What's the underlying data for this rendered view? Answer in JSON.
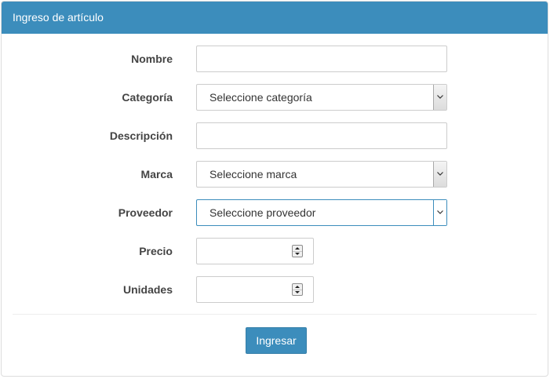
{
  "panel": {
    "title": "Ingreso de artículo"
  },
  "form": {
    "nombre": {
      "label": "Nombre",
      "value": ""
    },
    "categoria": {
      "label": "Categoría",
      "selected": "Seleccione categoría"
    },
    "descripcion": {
      "label": "Descripción",
      "value": ""
    },
    "marca": {
      "label": "Marca",
      "selected": "Seleccione marca"
    },
    "proveedor": {
      "label": "Proveedor",
      "selected": "Seleccione proveedor"
    },
    "precio": {
      "label": "Precio",
      "value": ""
    },
    "unidades": {
      "label": "Unidades",
      "value": ""
    }
  },
  "actions": {
    "submit_label": "Ingresar"
  },
  "colors": {
    "header": "#3c8dbc",
    "button": "#3c8dbc",
    "label_text": "#444444"
  },
  "icons": {
    "select_arrow": "chevron-down-icon",
    "spin_up": "triangle-up-icon",
    "spin_down": "triangle-down-icon"
  }
}
